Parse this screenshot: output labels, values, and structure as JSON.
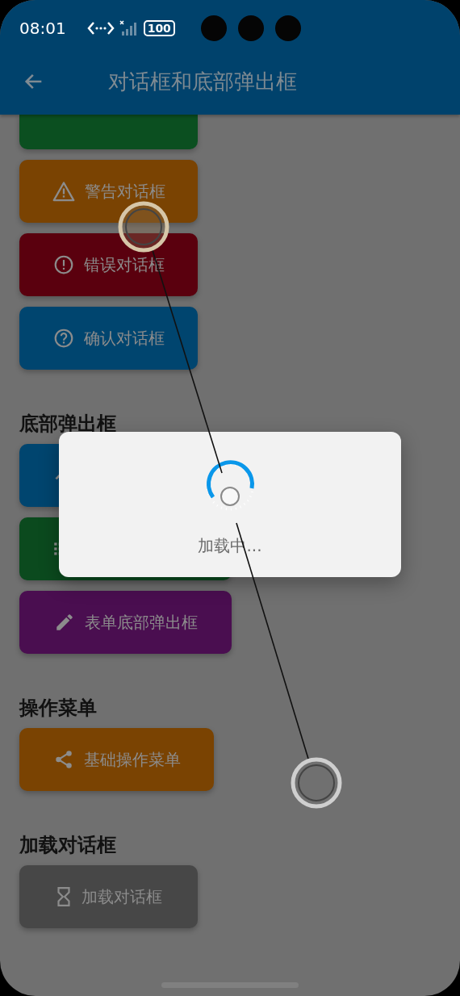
{
  "status_bar": {
    "time": "08:01",
    "battery": "100"
  },
  "app_bar": {
    "title": "对话框和底部弹出框"
  },
  "sections": [
    {
      "buttons": [
        {
          "kind": "success",
          "color": "#0b4f20",
          "cut_off": true
        },
        {
          "label": "警告对话框",
          "kind": "warning",
          "color": "#7a4302"
        },
        {
          "label": "错误对话框",
          "kind": "error",
          "color": "#5a000e"
        },
        {
          "label": "确认对话框",
          "kind": "question",
          "color": "#00456f"
        }
      ]
    },
    {
      "heading": "底部弹出框",
      "buttons": [
        {
          "kind": "up",
          "color": "#00456f"
        },
        {
          "kind": "list",
          "color": "#0b4a1e"
        },
        {
          "label": "表单底部弹出框",
          "kind": "edit",
          "color": "#4a0e50"
        }
      ]
    },
    {
      "heading": "操作菜单",
      "buttons": [
        {
          "label": "基础操作菜单",
          "kind": "share",
          "color": "#7a4302"
        }
      ]
    },
    {
      "heading": "加载对话框",
      "buttons": [
        {
          "label": "加载对话框",
          "kind": "hourglass",
          "color": "#474747"
        }
      ]
    }
  ],
  "dialog": {
    "message": "加载中..."
  }
}
